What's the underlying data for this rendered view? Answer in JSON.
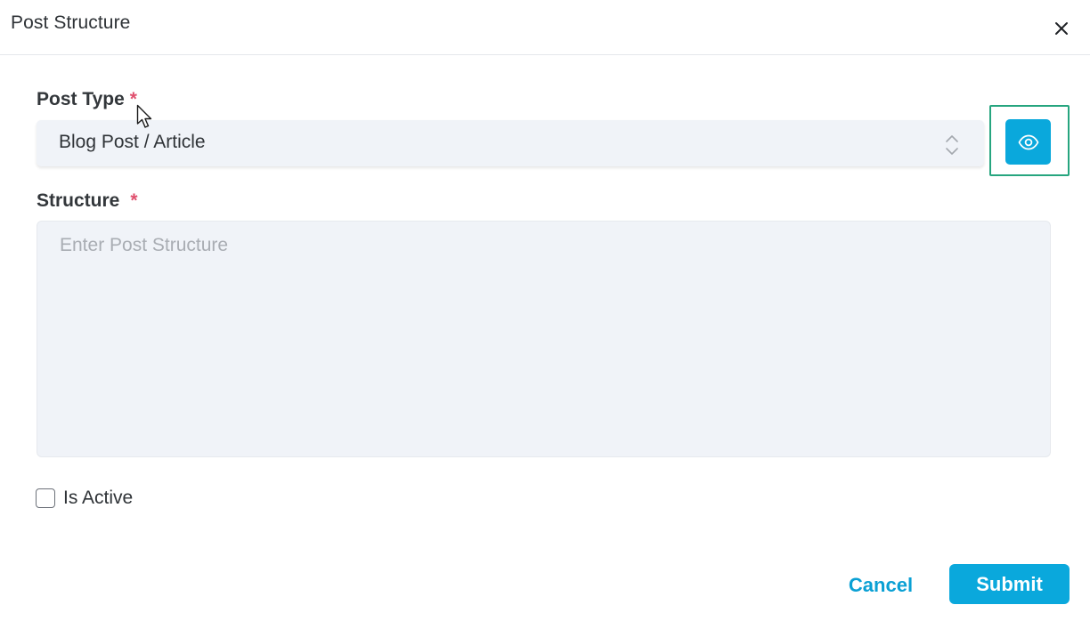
{
  "dialog": {
    "title": "Post Structure",
    "close_icon": "close-icon"
  },
  "post_type": {
    "label": "Post Type",
    "required_mark": "*",
    "selected_value": "Blog Post / Article",
    "select_icon": "chevron-up-down-icon",
    "preview_icon": "eye-icon"
  },
  "structure": {
    "label": "Structure",
    "required_mark": "*",
    "placeholder": "Enter Post Structure",
    "value": ""
  },
  "is_active": {
    "label": "Is Active",
    "checked": false
  },
  "footer": {
    "cancel_label": "Cancel",
    "submit_label": "Submit"
  },
  "colors": {
    "accent": "#0aa8dc",
    "required": "#e0506e",
    "highlight_frame": "#26a57f",
    "field_background": "#f0f3f8"
  }
}
